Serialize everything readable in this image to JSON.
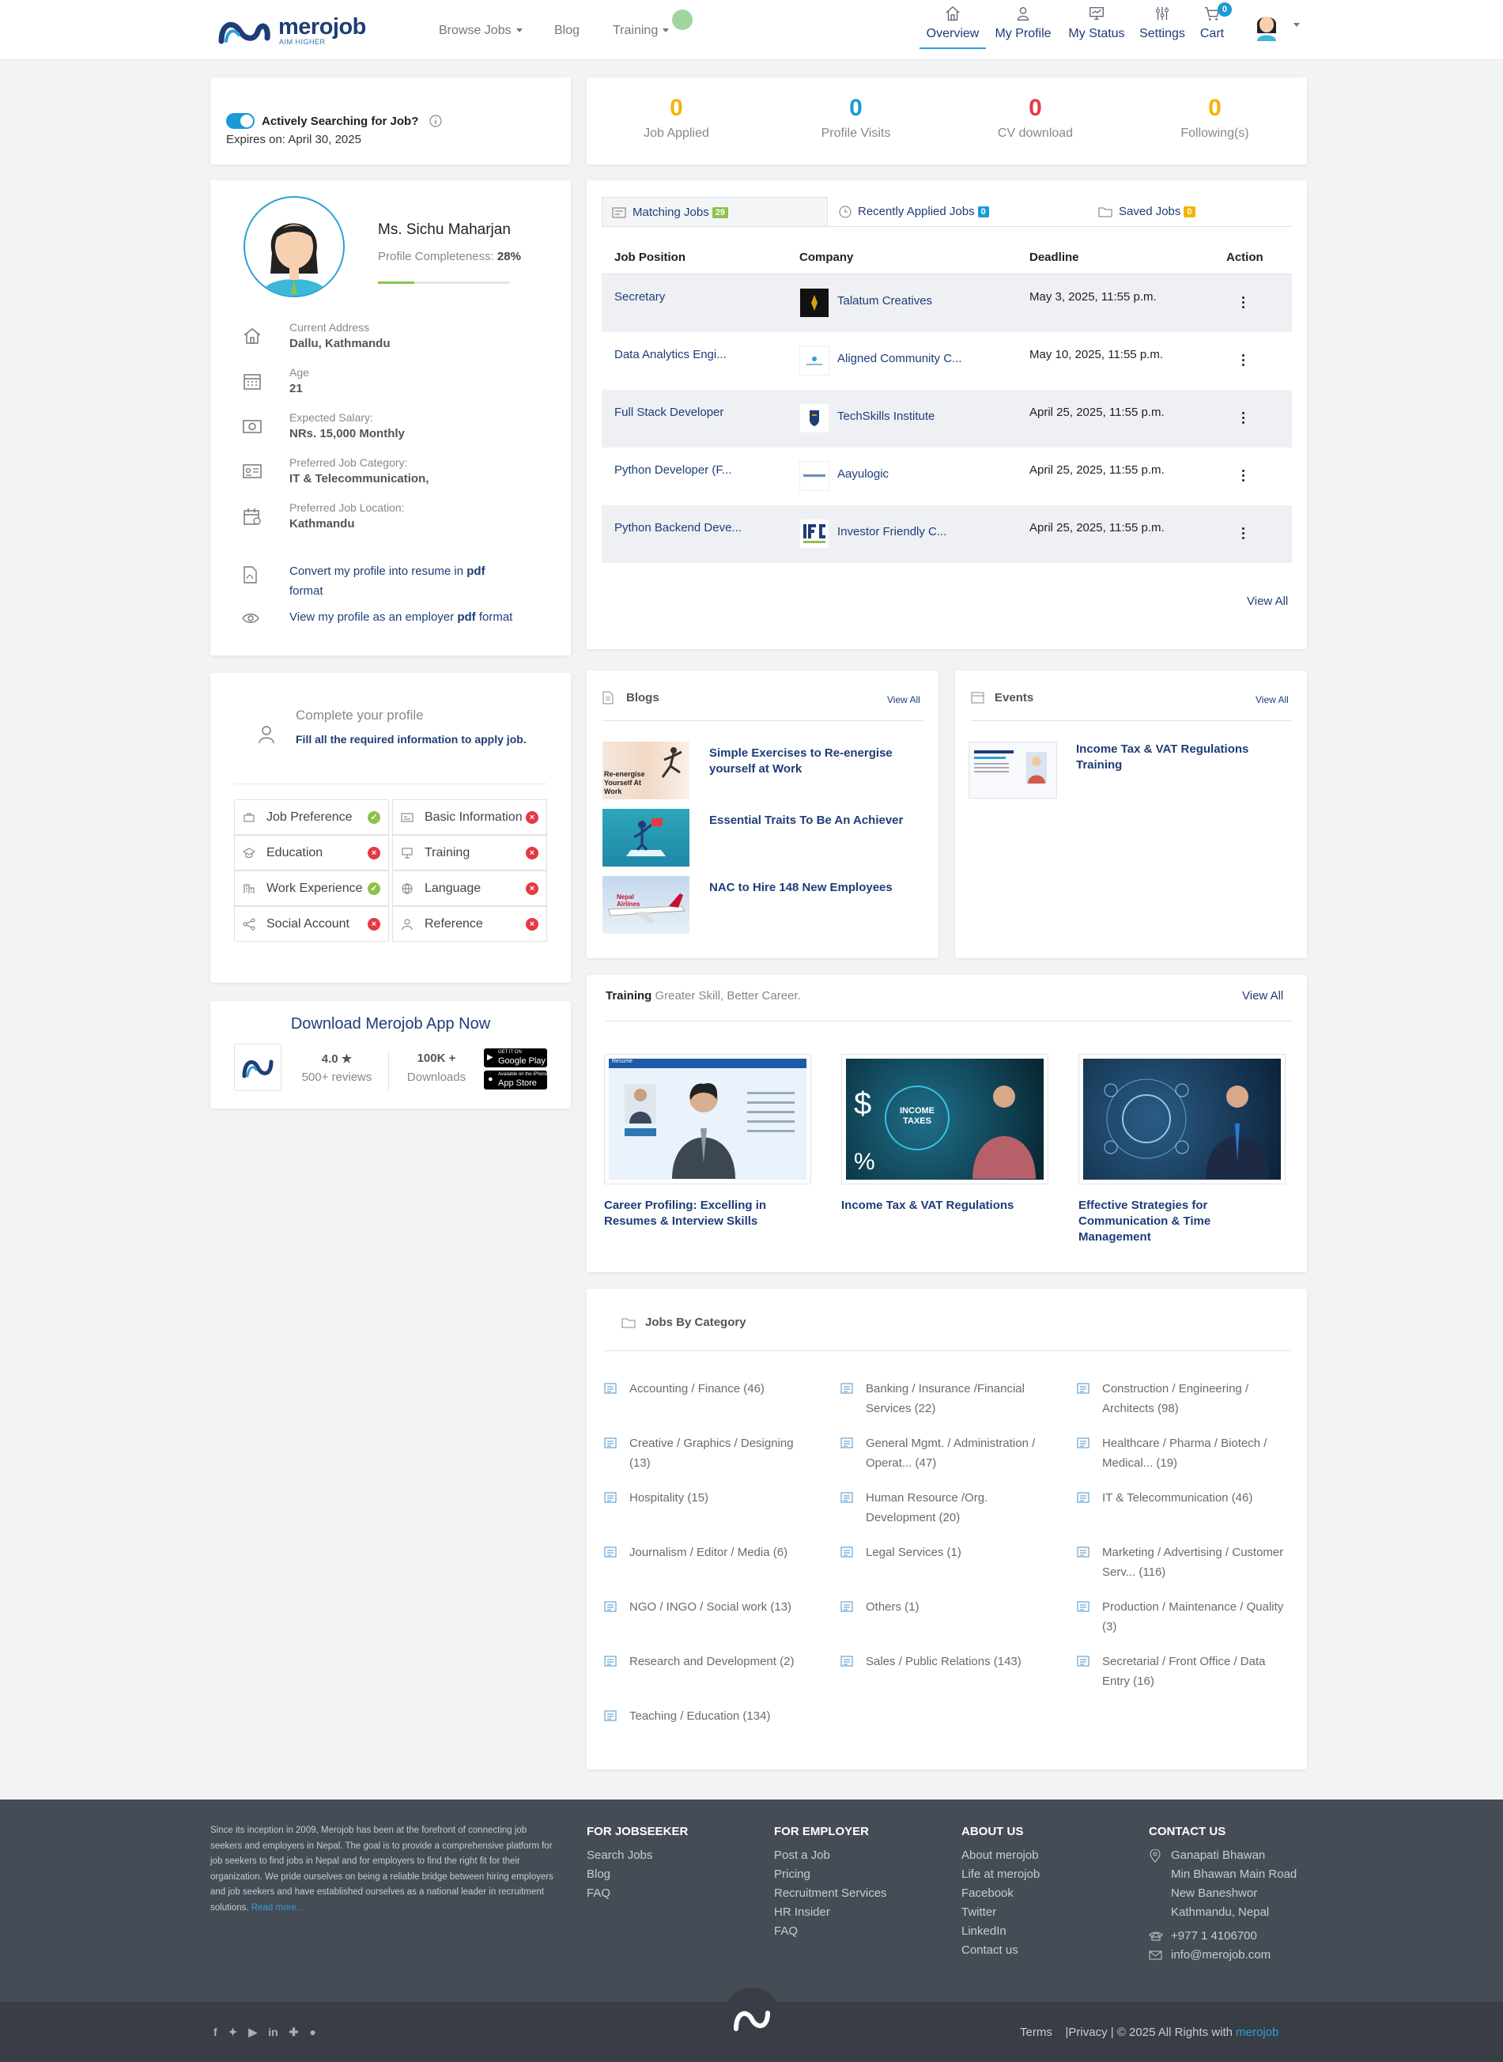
{
  "header": {
    "logo_text": "merojob",
    "logo_tagline": "AIM HIGHER",
    "nav_left": [
      "Browse Jobs",
      "Blog",
      "Training"
    ],
    "nav_right": [
      {
        "label": "Overview",
        "icon": "home-icon"
      },
      {
        "label": "My Profile",
        "icon": "user-icon"
      },
      {
        "label": "My Status",
        "icon": "monitor-icon"
      },
      {
        "label": "Settings",
        "icon": "sliders-icon"
      },
      {
        "label": "Cart",
        "icon": "cart-icon",
        "badge": "0"
      }
    ],
    "active_tab": "Overview"
  },
  "job_search": {
    "label": "Actively Searching for Job?",
    "expires": "Expires on: April 30, 2025",
    "enabled": true
  },
  "stats": [
    {
      "value": "0",
      "label": "Job Applied",
      "color": "#f5b301"
    },
    {
      "value": "0",
      "label": "Profile Visits",
      "color": "#1a9ad6"
    },
    {
      "value": "0",
      "label": "CV download",
      "color": "#e53945"
    },
    {
      "value": "0",
      "label": "Following(s)",
      "color": "#f5b301"
    }
  ],
  "profile": {
    "name": "Ms. Sichu Maharjan",
    "completeness_label": "Profile Completeness:",
    "completeness_value": "28%",
    "completeness_fraction": 0.28,
    "fields": [
      {
        "key": "Current Address",
        "value": "Dallu, Kathmandu",
        "icon": "home-icon"
      },
      {
        "key": "Age",
        "value": "21",
        "icon": "calendar-icon"
      },
      {
        "key": "Expected Salary:",
        "value": "NRs. 15,000 Monthly",
        "icon": "money-icon"
      },
      {
        "key": "Preferred Job Category:",
        "value": "IT & Telecommunication,",
        "icon": "id-card-icon"
      },
      {
        "key": "Preferred Job Location:",
        "value": "Kathmandu",
        "icon": "location-calendar-icon"
      }
    ],
    "convert_text_1": "Convert my profile into resume in",
    "convert_bold": "pdf",
    "convert_text_2": "format",
    "view_text_1": "View my profile as an employer",
    "view_bold": "pdf",
    "view_text_2": "format"
  },
  "complete_profile": {
    "title": "Complete your profile",
    "subtitle": "Fill all the required information to apply job.",
    "items": [
      {
        "label": "Job Preference",
        "done": true,
        "icon": "briefcase-icon"
      },
      {
        "label": "Basic Information",
        "done": false,
        "icon": "id-card-icon"
      },
      {
        "label": "Education",
        "done": false,
        "icon": "graduation-icon"
      },
      {
        "label": "Training",
        "done": false,
        "icon": "presentation-icon"
      },
      {
        "label": "Work Experience",
        "done": true,
        "icon": "building-icon"
      },
      {
        "label": "Language",
        "done": false,
        "icon": "globe-icon"
      },
      {
        "label": "Social Account",
        "done": false,
        "icon": "share-icon"
      },
      {
        "label": "Reference",
        "done": false,
        "icon": "person-icon"
      }
    ]
  },
  "app": {
    "title": "Download Merojob App Now",
    "rating": "4.0",
    "reviews": "500+ reviews",
    "downloads": "100K +",
    "downloads_label": "Downloads",
    "google_small": "GET IT ON",
    "google": "Google Play",
    "apple_small": "Available on the iPhone",
    "apple": "App Store"
  },
  "jobs_tabs": [
    {
      "label": "Matching Jobs",
      "count": "29",
      "color": "#8bc34a"
    },
    {
      "label": "Recently Applied Jobs",
      "count": "0",
      "color": "#1a9ad6"
    },
    {
      "label": "Saved Jobs",
      "count": "0",
      "color": "#f5b301"
    }
  ],
  "jobs_table": {
    "headers": [
      "Job Position",
      "Company",
      "Deadline",
      "Action"
    ],
    "rows": [
      {
        "position": "Secretary",
        "company": "Talatum Creatives",
        "deadline": "May 3, 2025, 11:55 p.m."
      },
      {
        "position": "Data Analytics Engi...",
        "company": "Aligned Community C...",
        "deadline": "May 10, 2025, 11:55 p.m."
      },
      {
        "position": "Full Stack Developer",
        "company": "TechSkills Institute",
        "deadline": "April 25, 2025, 11:55 p.m."
      },
      {
        "position": "Python Developer (F...",
        "company": "Aayulogic",
        "deadline": "April 25, 2025, 11:55 p.m."
      },
      {
        "position": "Python Backend Deve...",
        "company": "Investor Friendly C...",
        "deadline": "April 25, 2025, 11:55 p.m."
      }
    ],
    "view_all": "View All"
  },
  "blogs": {
    "title": "Blogs",
    "view_all": "View All",
    "items": [
      {
        "title": "Simple Exercises to Re-energise yourself at Work",
        "img_text": "Re-energise Yourself At Work"
      },
      {
        "title": "Essential Traits To Be An Achiever",
        "img_text": ""
      },
      {
        "title": "NAC to Hire 148 New Employees",
        "img_text": "Nepal Airlines"
      }
    ]
  },
  "events": {
    "title": "Events",
    "view_all": "View All",
    "items": [
      {
        "title": "Income Tax & VAT Regulations Training"
      }
    ]
  },
  "training": {
    "title": "Training",
    "subtitle": "Greater Skill, Better Career.",
    "view_all": "View All",
    "items": [
      {
        "title": "Career Profiling: Excelling in Resumes & Interview Skills",
        "img_text": "Resume"
      },
      {
        "title": "Income Tax & VAT Regulations",
        "img_text": "INCOME TAXES"
      },
      {
        "title": "Effective Strategies for Communication & Time Management",
        "img_text": ""
      }
    ]
  },
  "categories": {
    "title": "Jobs By Category",
    "items": [
      "Accounting / Finance (46)",
      "Banking / Insurance /Financial Services (22)",
      "Construction / Engineering / Architects (98)",
      "Creative / Graphics / Designing (13)",
      "General Mgmt. / Administration / Operat... (47)",
      "Healthcare / Pharma / Biotech / Medical... (19)",
      "Hospitality (15)",
      "Human Resource /Org. Development (20)",
      "IT & Telecommunication (46)",
      "Journalism / Editor / Media (6)",
      "Legal Services (1)",
      "Marketing / Advertising / Customer Serv... (116)",
      "NGO / INGO / Social work (13)",
      "Others (1)",
      "Production / Maintenance / Quality (3)",
      "Research and Development (2)",
      "Sales / Public Relations (143)",
      "Secretarial / Front Office / Data Entry (16)",
      "Teaching / Education (134)"
    ]
  },
  "footer": {
    "about": "Since its inception in 2009, Merojob has been at the forefront of connecting job seekers and employers in Nepal. The goal is to provide a comprehensive platform for job seekers to find jobs in Nepal and for employers to find the right fit for their organization. We pride ourselves on being a reliable bridge between hiring employers and job seekers and have established ourselves as a national leader in recruitment solutions.",
    "read_more": "Read more...",
    "jobseeker_title": "FOR JOBSEEKER",
    "jobseeker": [
      "Search Jobs",
      "Blog",
      "FAQ"
    ],
    "employer_title": "FOR EMPLOYER",
    "employer": [
      "Post a Job",
      "Pricing",
      "Recruitment Services",
      "HR Insider",
      "FAQ"
    ],
    "about_title": "ABOUT US",
    "about_links": [
      "About merojob",
      "Life at merojob",
      "Facebook",
      "Twitter",
      "LinkedIn",
      "Contact us"
    ],
    "contact_title": "CONTACT US",
    "address": [
      "Ganapati Bhawan",
      "Min Bhawan Main Road",
      "New Baneshwor",
      "Kathmandu, Nepal"
    ],
    "phone": "+977 1 4106700",
    "email": "info@merojob.com",
    "terms": "Terms",
    "privacy": "|Privacy",
    "copyright": "| © 2025 All Rights with",
    "brand": "merojob"
  }
}
